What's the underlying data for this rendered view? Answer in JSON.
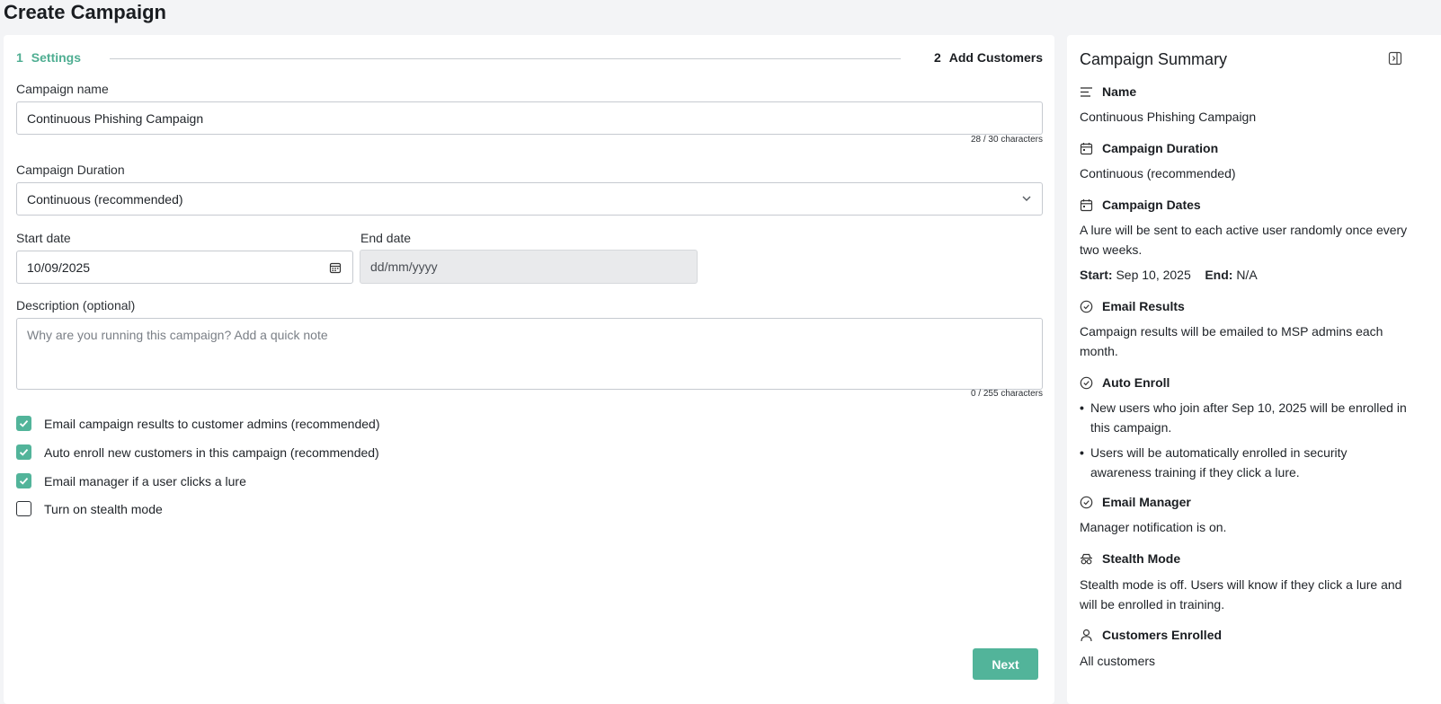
{
  "page": {
    "title": "Create Campaign"
  },
  "stepper": {
    "step1_num": "1",
    "step1_label": "Settings",
    "step2_num": "2",
    "step2_label": "Add Customers"
  },
  "form": {
    "campaign_name_label": "Campaign name",
    "campaign_name_value": "Continuous Phishing Campaign",
    "campaign_name_counter": "28 / 30 characters",
    "duration_label": "Campaign Duration",
    "duration_value": "Continuous (recommended)",
    "start_date_label": "Start date",
    "start_date_value": "10/09/2025",
    "end_date_label": "End date",
    "end_date_placeholder": "dd/mm/yyyy",
    "description_label": "Description (optional)",
    "description_placeholder": "Why are you running this campaign? Add a quick note",
    "description_counter": "0 / 255 characters",
    "checkboxes": [
      {
        "label": "Email campaign results to customer admins (recommended)",
        "checked": true
      },
      {
        "label": "Auto enroll new customers in this campaign (recommended)",
        "checked": true
      },
      {
        "label": "Email manager if a user clicks a lure",
        "checked": true
      },
      {
        "label": "Turn on stealth mode",
        "checked": false
      }
    ],
    "next_label": "Next"
  },
  "summary": {
    "title": "Campaign Summary",
    "name_head": "Name",
    "name_value": "Continuous Phishing Campaign",
    "duration_head": "Campaign Duration",
    "duration_value": "Continuous (recommended)",
    "dates_head": "Campaign Dates",
    "dates_text": "A lure will be sent to each active user randomly once every two weeks.",
    "start_label": "Start:",
    "start_value": "Sep 10, 2025",
    "end_label": "End:",
    "end_value": "N/A",
    "email_results_head": "Email Results",
    "email_results_text": "Campaign results will be emailed to MSP admins each month.",
    "auto_enroll_head": "Auto Enroll",
    "auto_enroll_bullets": [
      "New users who join after Sep 10, 2025 will be enrolled in this campaign.",
      "Users will be automatically enrolled in security awareness training if they click a lure."
    ],
    "email_manager_head": "Email Manager",
    "email_manager_text": "Manager notification is on.",
    "stealth_head": "Stealth Mode",
    "stealth_text": "Stealth mode is off. Users will know if they click a lure and will be enrolled in training.",
    "customers_head": "Customers Enrolled",
    "customers_text": "All customers"
  },
  "colors": {
    "accent": "#52b49a",
    "step_active": "#4fae92"
  }
}
